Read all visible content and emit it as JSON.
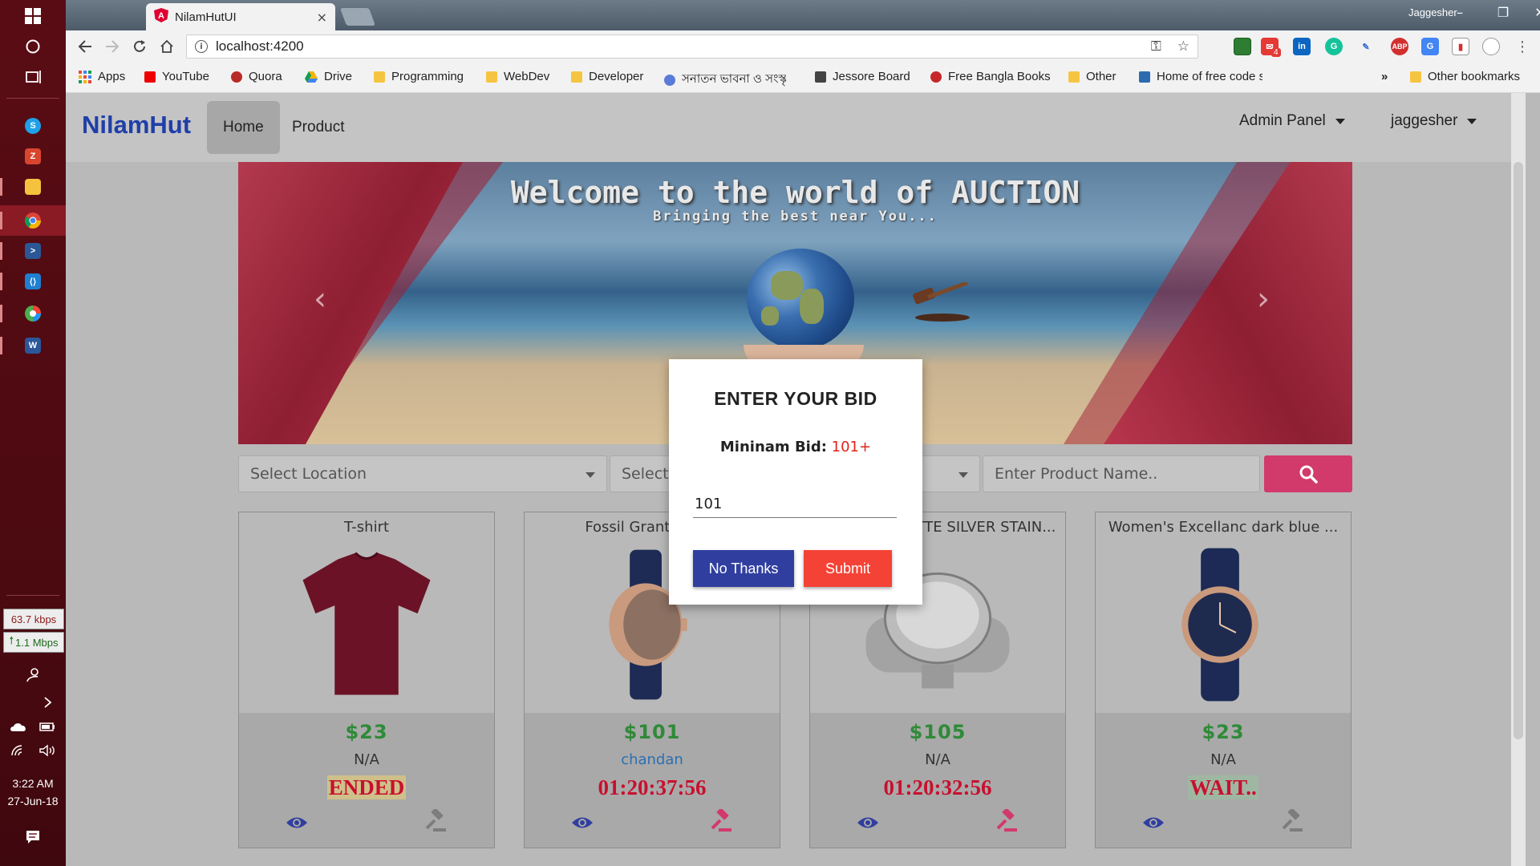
{
  "taskbar": {
    "net_down": "63.7 kbps",
    "net_up": "1.1 Mbps",
    "clock_time": "3:22 AM",
    "clock_date": "27-Jun-18"
  },
  "browser": {
    "tab_title": "NilamHutUI",
    "tab_close": "×",
    "window_user": "Jaggesher",
    "url": "localhost:4200",
    "bookmarks_overflow": "»",
    "bookmarks": [
      {
        "label": "Apps"
      },
      {
        "label": "YouTube"
      },
      {
        "label": "Quora"
      },
      {
        "label": "Drive"
      },
      {
        "label": "Programming"
      },
      {
        "label": "WebDev"
      },
      {
        "label": "Developer"
      },
      {
        "label": "সনাতন ভাবনা ও সংস্কৃ"
      },
      {
        "label": "Jessore Board"
      },
      {
        "label": "Free Bangla Books"
      },
      {
        "label": "Other"
      },
      {
        "label": "Home of free code s"
      },
      {
        "label": "Other bookmarks"
      }
    ],
    "extension_badge": "4"
  },
  "navbar": {
    "brand": "NilamHut",
    "home": "Home",
    "product": "Product",
    "admin": "Admin Panel",
    "user": "jaggesher"
  },
  "banner": {
    "title": "Welcome to the world of AUCTION",
    "subtitle": "Bringing the best near You..."
  },
  "search": {
    "location_placeholder": "Select Location",
    "category_placeholder": "Select c",
    "product_placeholder": "Enter Product Name.."
  },
  "products": [
    {
      "title": "T-shirt",
      "price": "$23",
      "bidder": "N/A",
      "status": "ENDED"
    },
    {
      "title": "Fossil Grant Blue L",
      "price": "$101",
      "bidder": "chandan",
      "status": "01:20:37:56"
    },
    {
      "title": "TTE SILVER STAIN...",
      "price": "$105",
      "bidder": "N/A",
      "status": "01:20:32:56"
    },
    {
      "title": "Women's Excellanc dark blue ...",
      "price": "$23",
      "bidder": "N/A",
      "status": "WAIT.."
    }
  ],
  "modal": {
    "title": "ENTER YOUR BID",
    "min_label": "Mininam Bid:",
    "min_value": "101+",
    "bid_value": "101",
    "no_thanks": "No Thanks",
    "submit": "Submit"
  },
  "colors": {
    "brand": "#1f3fa8",
    "accent": "#d23a6c",
    "price": "#2f8a38",
    "status": "#c8102e",
    "modal_primary": "#303f9f",
    "modal_danger": "#f44336"
  }
}
